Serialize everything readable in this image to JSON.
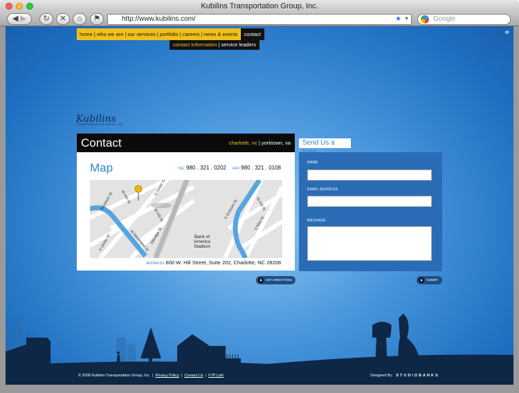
{
  "window": {
    "title": "Kubilins Transportation Group, Inc."
  },
  "browser": {
    "url": "http://www.kubilins.com/",
    "search_placeholder": "Google"
  },
  "nav": {
    "main": [
      "home",
      "who we are",
      "our services",
      "portfolio",
      "careers",
      "news & events"
    ],
    "active": "contact",
    "sub_current": "contact information",
    "sub_other": "service leaders"
  },
  "logo": {
    "script": "Kubilins",
    "sub": "TRANSPORTATION GROUP, INC."
  },
  "contact": {
    "title": "Contact",
    "city_current": "charlotte, nc",
    "city_other": "yorktown, va"
  },
  "map_section": {
    "title": "Map",
    "tel_label": "TEL",
    "tel": "980 . 321 . 0202",
    "fax_label": "FAX",
    "fax": "980 . 321 . 0108",
    "address_label": "ADDRESS",
    "address": "800 W. Hill Street, Suite 202, Charlotte, NC 28208",
    "streets": [
      "Mcintosh St",
      "W Hill St",
      "S Cedar St",
      "W Hill St",
      "S Cedar St",
      "W Morehead St",
      "Elkridge St",
      "S Graham St",
      "W Hill St",
      "S Mint St"
    ],
    "poi": "Bank of America Stadium"
  },
  "directions_button": "GET DIRECTIONS",
  "note_form": {
    "tab": "Send Us a Note",
    "name_label": "NAME",
    "email_label": "EMAIL ADDRESS",
    "message_label": "MESSAGE",
    "submit": "SUBMIT"
  },
  "footer": {
    "copyright": "© 2008 Kubilins Transportation Group, Inc.",
    "links": [
      "Privacy Policy",
      "Contact Us",
      "FTP Link"
    ],
    "designed_by": "Designed By:",
    "designer": "STUDIOBANKS"
  },
  "colors": {
    "accent": "#f2c01b",
    "blue": "#2f86d0",
    "panel": "#2a6db6"
  }
}
